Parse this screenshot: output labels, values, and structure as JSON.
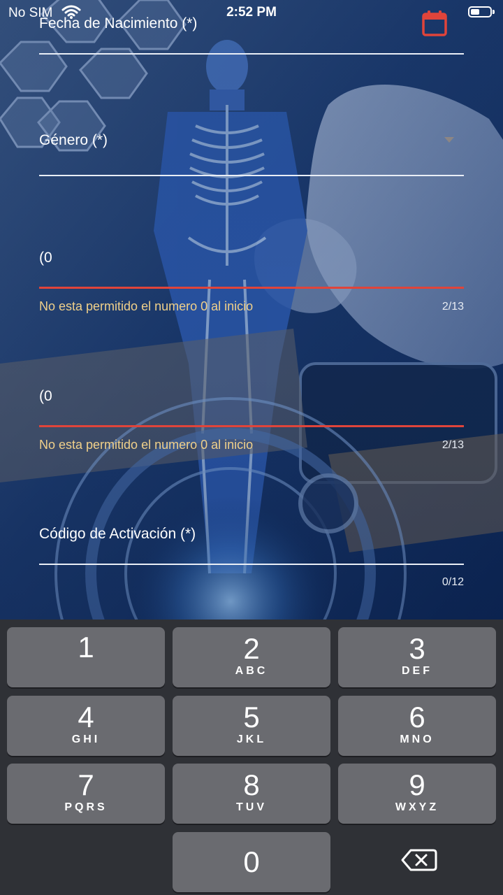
{
  "status_bar": {
    "carrier": "No SIM",
    "time": "2:52 PM"
  },
  "form": {
    "birth_date": {
      "label": "Fecha de Nacimiento (*)"
    },
    "gender": {
      "label": "Género (*)"
    },
    "phone1": {
      "value": "(0",
      "error": "No esta permitido el numero 0 al inicio",
      "counter": "2/13"
    },
    "phone2": {
      "value": "(0",
      "error": "No esta permitido el numero 0 al inicio",
      "counter": "2/13"
    },
    "activation_code": {
      "label": "Código de Activación (*)",
      "counter": "0/12"
    }
  },
  "colors": {
    "error_line": "#e0443a",
    "helper_text": "#f0d08a",
    "calendar_icon": "#e0443a"
  },
  "keypad": {
    "keys": [
      {
        "num": "1",
        "letters": ""
      },
      {
        "num": "2",
        "letters": "ABC"
      },
      {
        "num": "3",
        "letters": "DEF"
      },
      {
        "num": "4",
        "letters": "GHI"
      },
      {
        "num": "5",
        "letters": "JKL"
      },
      {
        "num": "6",
        "letters": "MNO"
      },
      {
        "num": "7",
        "letters": "PQRS"
      },
      {
        "num": "8",
        "letters": "TUV"
      },
      {
        "num": "9",
        "letters": "WXYZ"
      },
      {
        "num": "0",
        "letters": ""
      }
    ],
    "delete_icon": "backspace-icon"
  }
}
